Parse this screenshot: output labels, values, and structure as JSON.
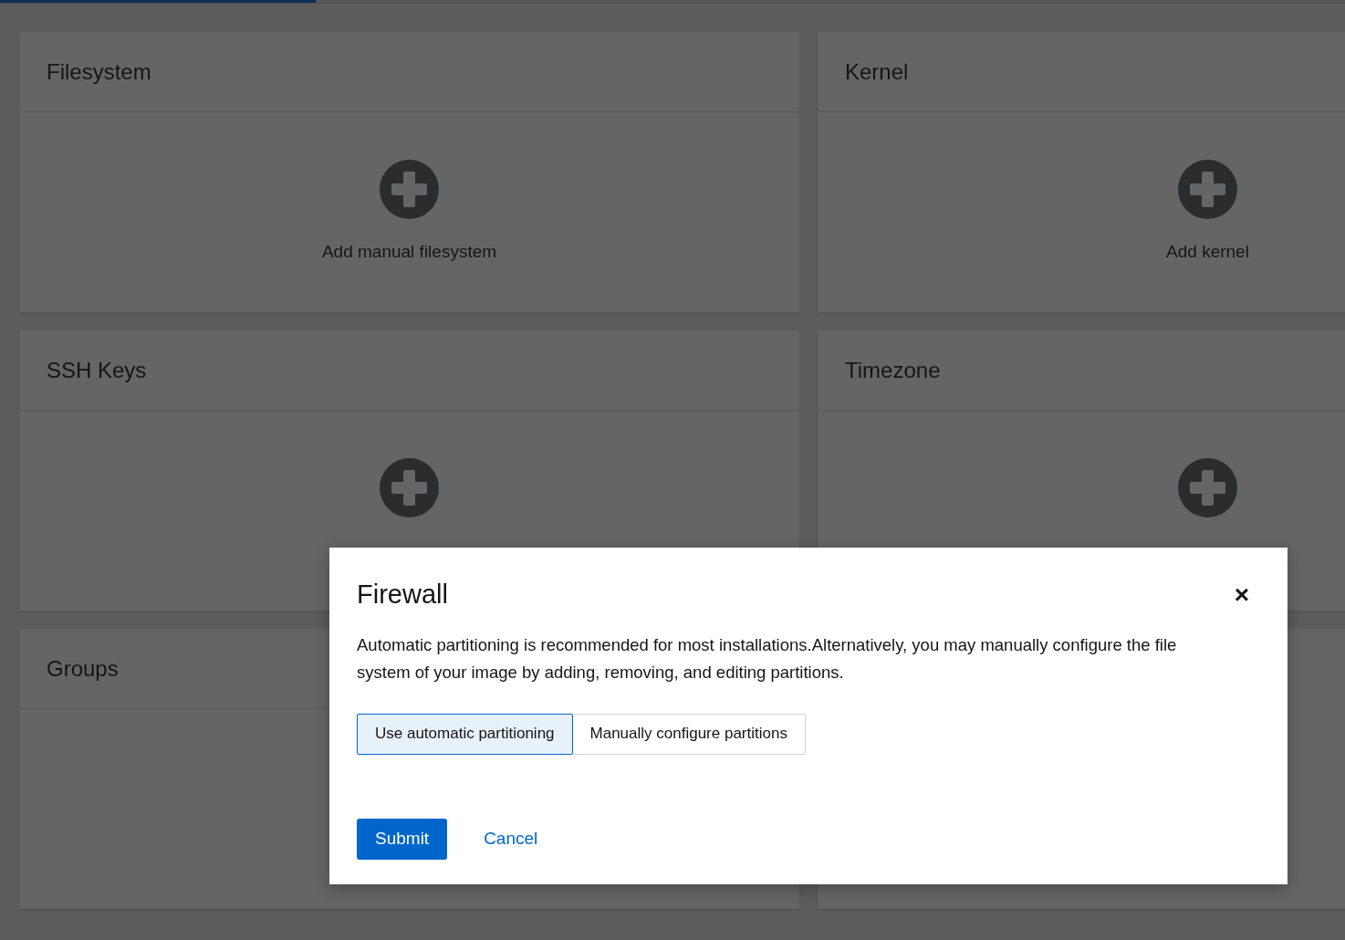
{
  "progress": {
    "level": 0.235
  },
  "cards": [
    {
      "kind": "action",
      "title": "Filesystem",
      "action": "Add manual filesystem"
    },
    {
      "kind": "action",
      "title": "Kernel",
      "action": "Add kernel"
    },
    {
      "kind": "action",
      "title": "SSH Keys"
    },
    {
      "kind": "action",
      "title": "Timezone"
    },
    {
      "kind": "title_only",
      "title": "Groups"
    },
    {
      "kind": "blank"
    }
  ],
  "modal": {
    "title": "Firewall",
    "close": "×",
    "text": "Automatic partitioning is recommended for most installations.Alternatively, you may manually configure the file system of your image by adding, removing, and editing partitions.",
    "options": [
      {
        "label": "Use automatic partitioning",
        "selected": true
      },
      {
        "label": "Manually configure partitions",
        "selected": false
      }
    ],
    "submit": "Submit",
    "cancel": "Cancel"
  }
}
